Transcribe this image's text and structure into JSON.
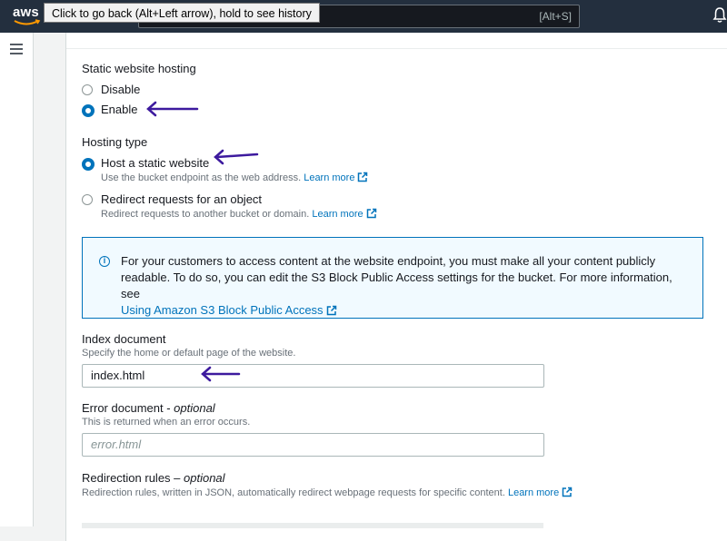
{
  "header": {
    "logo_text": "aws",
    "tooltip": "Click to go back (Alt+Left arrow), hold to see history",
    "search_shortcut": "[Alt+S]"
  },
  "static_hosting": {
    "label": "Static website hosting",
    "options": [
      {
        "label": "Disable",
        "checked": false
      },
      {
        "label": "Enable",
        "checked": true
      }
    ]
  },
  "hosting_type": {
    "label": "Hosting type",
    "options": [
      {
        "label": "Host a static website",
        "description": "Use the bucket endpoint as the web address.",
        "link": "Learn more",
        "checked": true
      },
      {
        "label": "Redirect requests for an object",
        "description": "Redirect requests to another bucket or domain.",
        "link": "Learn more",
        "checked": false
      }
    ]
  },
  "info": {
    "text": "For your customers to access content at the website endpoint, you must make all your content publicly readable. To do so, you can edit the S3 Block Public Access settings for the bucket. For more information, see",
    "link": "Using Amazon S3 Block Public Access"
  },
  "index_document": {
    "label": "Index document",
    "description": "Specify the home or default page of the website.",
    "value": "index.html"
  },
  "error_document": {
    "label": "Error document",
    "optional": "optional",
    "description": "This is returned when an error occurs.",
    "placeholder": "error.html"
  },
  "redirection_rules": {
    "label": "Redirection rules",
    "optional": "optional",
    "description": "Redirection rules, written in JSON, automatically redirect webpage requests for specific content.",
    "link": "Learn more"
  },
  "colors": {
    "accent": "#0073bb",
    "annotation_arrow": "#3d1a9e",
    "topbar": "#232f3e"
  }
}
